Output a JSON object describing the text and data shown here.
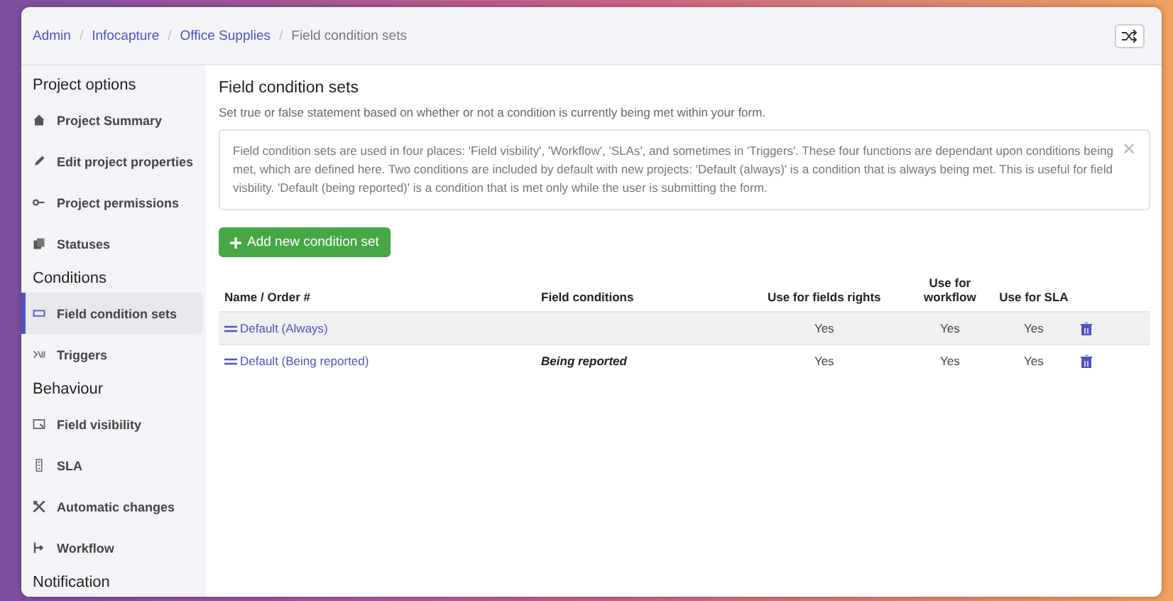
{
  "breadcrumb": [
    {
      "label": "Admin",
      "current": false
    },
    {
      "separator": "/",
      "label": "Infocapture",
      "current": false
    },
    {
      "separator": "/",
      "label": "Office Supplies",
      "current": false
    },
    {
      "separator": "/",
      "label": "Field condition sets",
      "current": true
    }
  ],
  "sidebar": {
    "sections": [
      {
        "heading": "Project options",
        "items": [
          {
            "label": "Project Summary",
            "selected": false
          },
          {
            "label": "Edit project properties",
            "selected": false
          },
          {
            "label": "Project permissions",
            "selected": false
          },
          {
            "label": "Statuses",
            "selected": false
          }
        ]
      },
      {
        "heading": "Conditions",
        "items": [
          {
            "label": "Field condition sets",
            "selected": true
          },
          {
            "label": "Triggers",
            "selected": false
          }
        ]
      },
      {
        "heading": "Behaviour",
        "items": [
          {
            "label": "Field visibility",
            "selected": false
          },
          {
            "label": "SLA",
            "selected": false
          },
          {
            "label": "Automatic changes",
            "selected": false
          },
          {
            "label": "Workflow",
            "selected": false
          }
        ]
      },
      {
        "heading": "Notification"
      }
    ]
  },
  "page": {
    "title": "Field condition sets",
    "subtitle": "Set true or false statement based on whether or not a condition is currently being met within your form.",
    "notice": "Field condition sets are used in four places: 'Field visbility', 'Workflow', 'SLAs', and sometimes in 'Triggers'. These four functions are dependant upon conditions being met, which are defined here. Two conditions are included by default with new projects: 'Default (always)' is a condition that is always being met. This is useful for field visbility. 'Default (being reported)' is a condition that is met only while the user is submitting the form.",
    "notice_close": "✕",
    "add_button": "Add new condition set"
  },
  "table": {
    "columns": [
      "Name / Order #",
      "Field conditions",
      "Use for fields rights",
      "Use for workflow",
      "Use for SLA"
    ],
    "rows": [
      {
        "name": "Default (Always)",
        "fields_rights": "Yes",
        "workflow": "Yes",
        "sla": "Yes",
        "highlighted": true
      },
      {
        "name": "Default (Being reported)",
        "conditions": "Being reported",
        "fields_rights": "Yes",
        "workflow": "Yes",
        "sla": "Yes",
        "highlighted": false
      }
    ]
  }
}
